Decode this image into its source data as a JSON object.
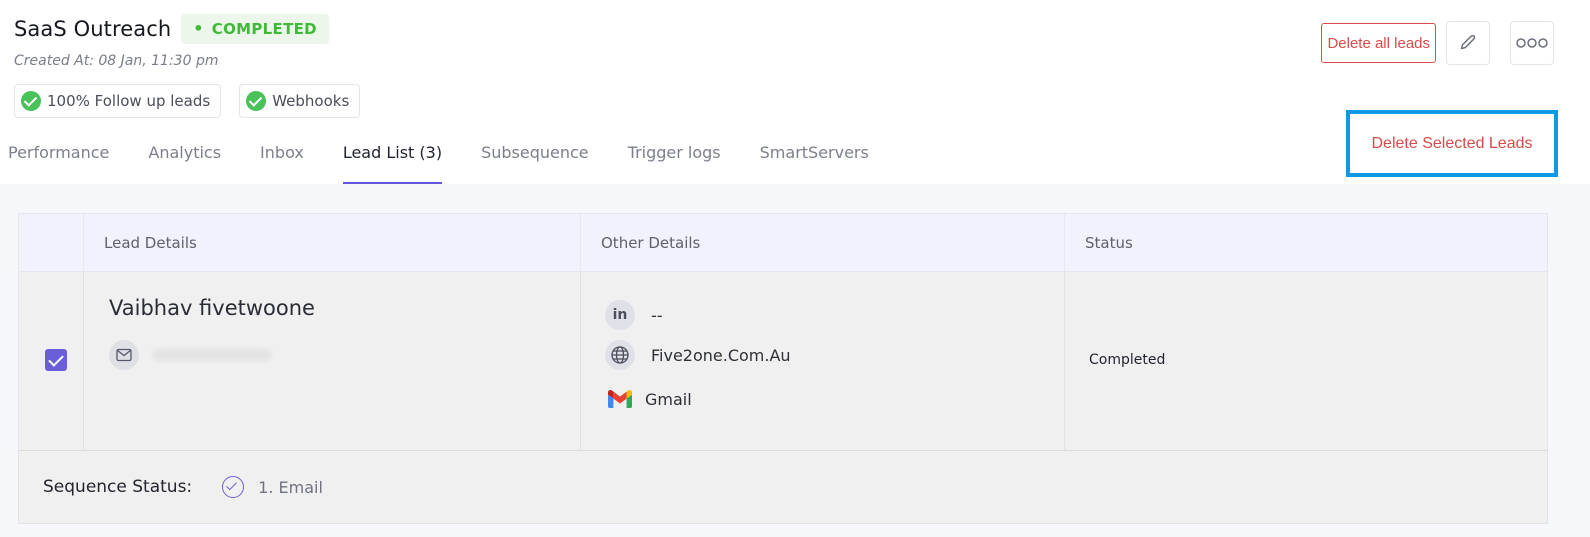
{
  "campaign": {
    "title": "SaaS Outreach",
    "status": "COMPLETED",
    "created_at": "Created At: 08 Jan, 11:30 pm"
  },
  "chips": [
    {
      "label": "100% Follow up leads",
      "icon": "check-circle-icon"
    },
    {
      "label": "Webhooks",
      "icon": "check-circle-icon"
    }
  ],
  "actions": {
    "delete_all": "Delete all leads",
    "delete_selected": "Delete Selected Leads",
    "edit_icon": "pencil-icon",
    "more_icon": "more-dots-icon"
  },
  "tabs": [
    {
      "label": "Performance",
      "active": false
    },
    {
      "label": "Analytics",
      "active": false
    },
    {
      "label": "Inbox",
      "active": false
    },
    {
      "label": "Lead List (3)",
      "active": true
    },
    {
      "label": "Subsequence",
      "active": false
    },
    {
      "label": "Trigger logs",
      "active": false
    },
    {
      "label": "SmartServers",
      "active": false
    }
  ],
  "table": {
    "columns": [
      "Lead Details",
      "Other Details",
      "Status"
    ],
    "rows": [
      {
        "selected": true,
        "name": "Vaibhav fivetwoone",
        "linkedin": "--",
        "website": "Five2one.Com.Au",
        "provider": "Gmail",
        "status": "Completed"
      }
    ],
    "sequence": {
      "label": "Sequence Status:",
      "step": "1. Email"
    }
  },
  "colors": {
    "accent": "#6656dd",
    "danger": "#d94a4a",
    "success": "#3dbb37",
    "highlight": "#0f98e3"
  }
}
